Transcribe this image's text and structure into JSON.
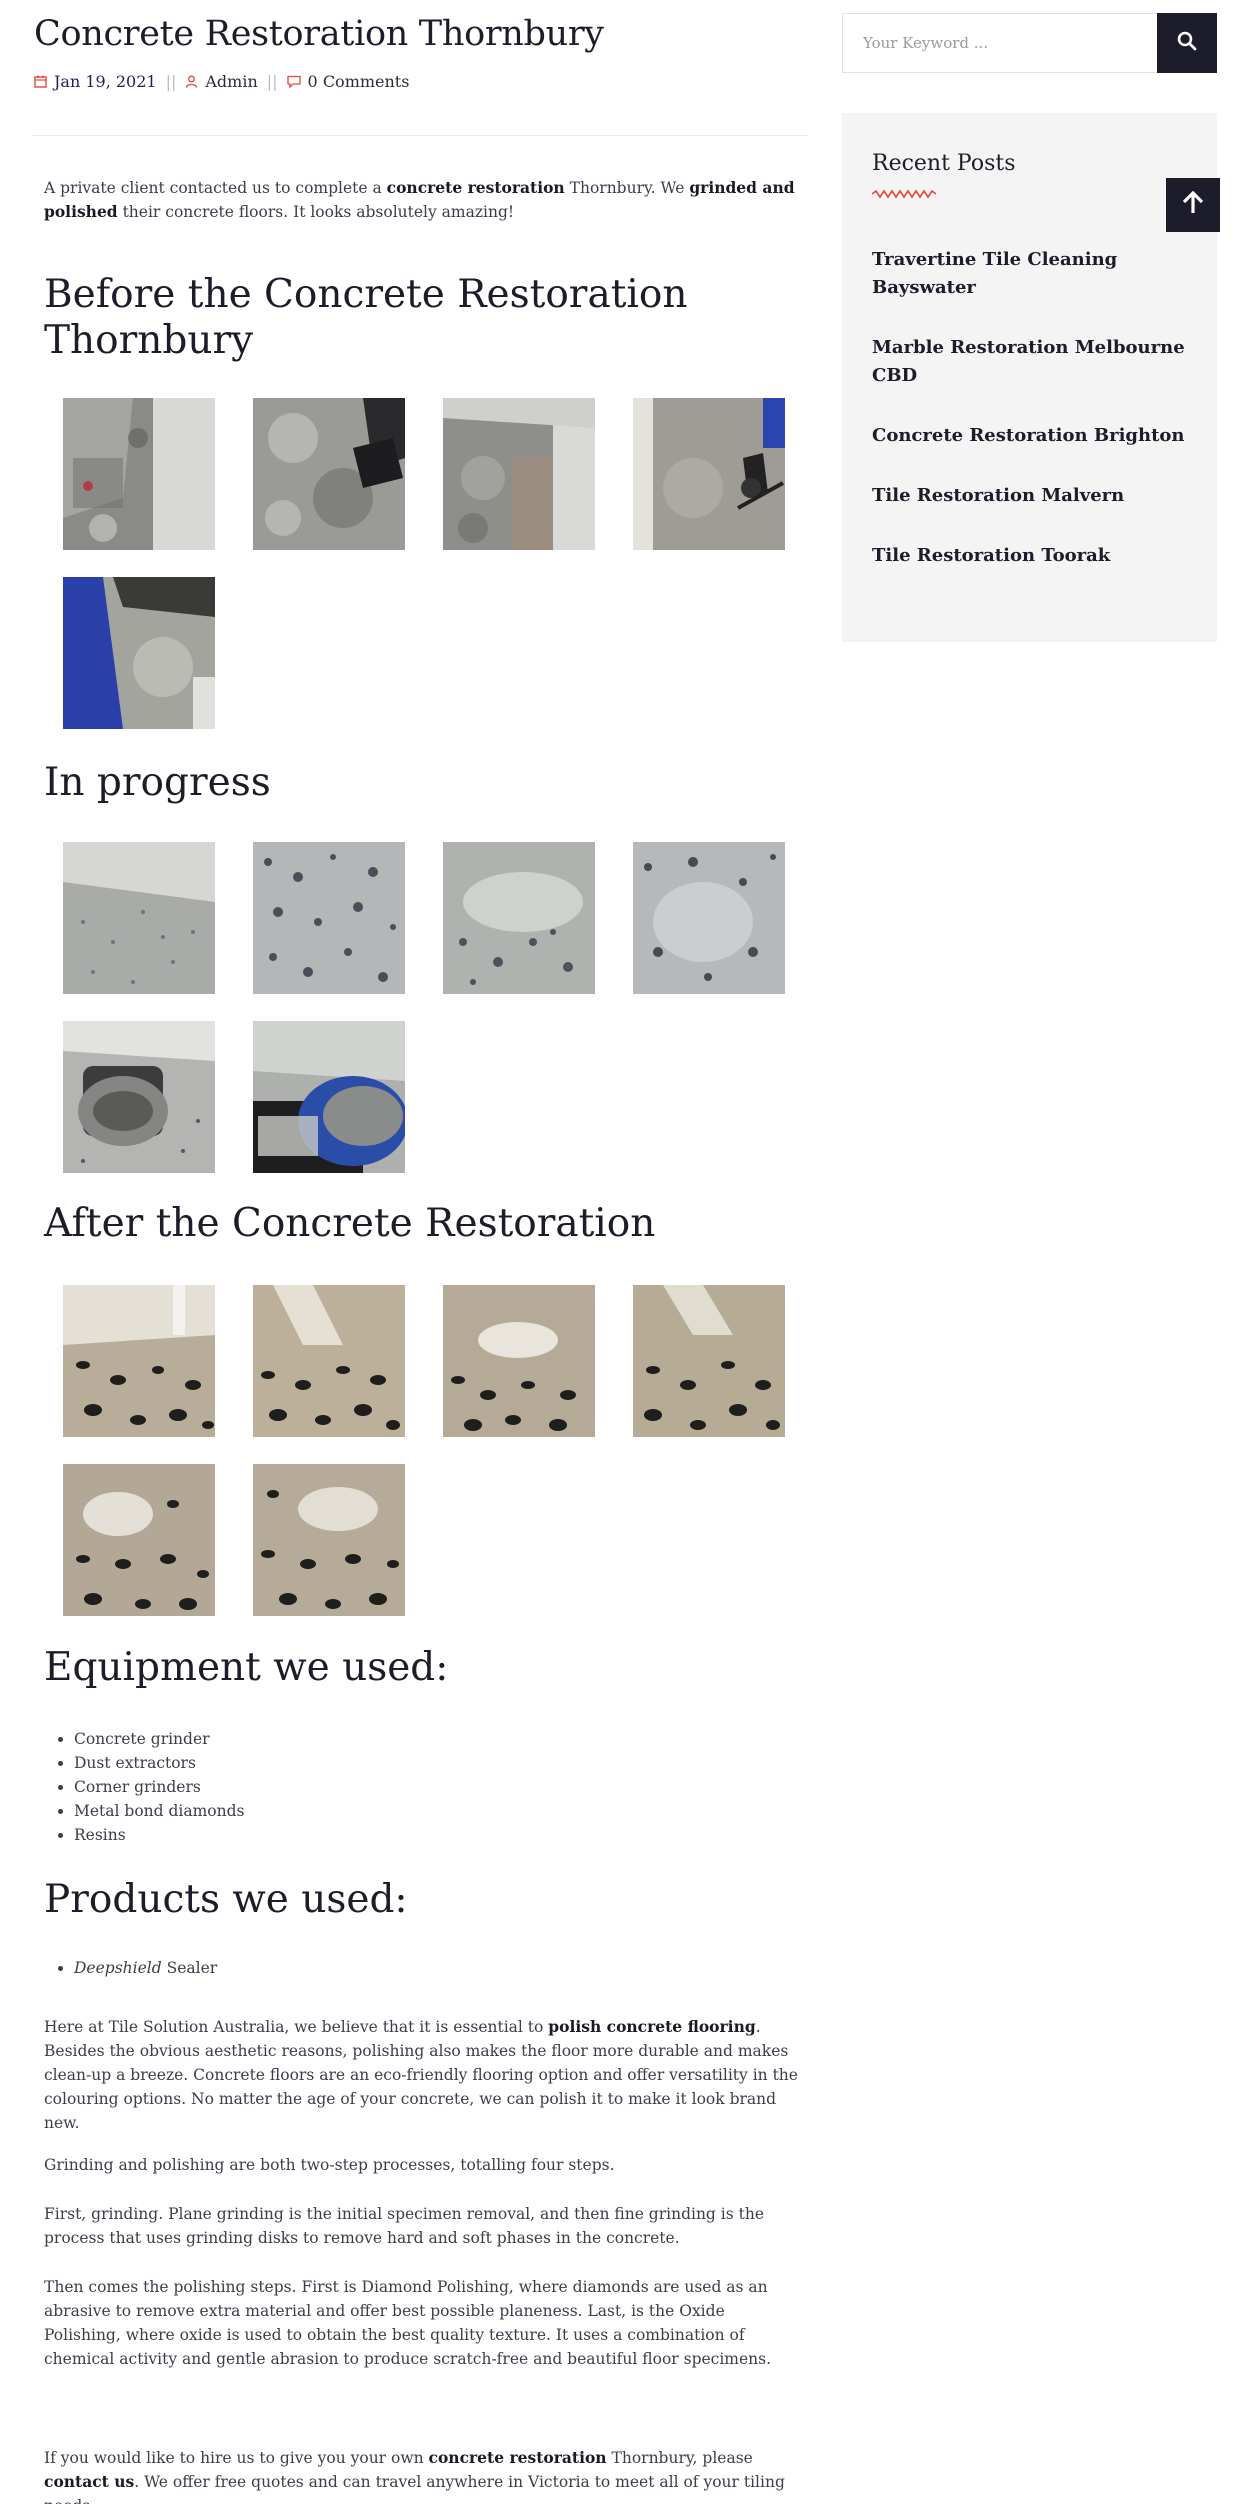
{
  "post": {
    "title": "Concrete Restoration Thornbury",
    "date": "Jan 19, 2021",
    "author": "Admin",
    "comments": "0 Comments"
  },
  "intro": {
    "t1": "A private client contacted us to complete a ",
    "b1": "concrete restoration",
    "t2": " Thornbury. We ",
    "b2": "grinded and polished",
    "t3": " their concrete floors. It looks absolutely amazing!"
  },
  "sections": {
    "before": "Before the Concrete Restoration Thornbury",
    "progress": "In progress",
    "after": "After the Concrete Restoration",
    "equipment": "Equipment we used:",
    "products": "Products we used:"
  },
  "equipment": [
    "Concrete grinder",
    "Dust extractors",
    "Corner grinders",
    "Metal bond diamonds",
    "Resins"
  ],
  "products": {
    "brand": "Deepshield",
    "rest": " Sealer"
  },
  "para1": {
    "t1": "Here at Tile Solution Australia, we believe that it is essential to ",
    "b1": "polish concrete flooring",
    "t2": ". Besides the obvious aesthetic reasons, polishing also makes the floor more durable and makes clean-up a breeze. Concrete floors are an eco-friendly flooring option and offer versatility in the colouring options. No matter the age of your concrete, we can polish it to make it look brand new."
  },
  "para2": "Grinding and polishing are both two-step processes, totalling four steps.",
  "para3": "First, grinding. Plane grinding is the initial specimen removal, and then fine grinding is the process that uses grinding disks to remove hard and soft phases in the concrete.",
  "para4": "Then comes the polishing steps. First is Diamond Polishing, where diamonds are used as an abrasive to remove extra material and offer best possible planeness. Last, is the Oxide Polishing, where oxide is used to obtain the best quality texture. It uses a combination of chemical activity and gentle abrasion to produce scratch-free and beautiful floor specimens.",
  "cta": {
    "t1": "If you would like to hire us to give you your own ",
    "b1": "concrete restoration",
    "t2": " Thornbury, please ",
    "b2": "contact us",
    "t3": ". We offer free quotes and can travel anywhere in Victoria to meet all of your tiling needs."
  },
  "sidebar": {
    "search_placeholder": "Your Keyword ...",
    "recent_title": "Recent Posts",
    "recent": [
      "Travertine Tile Cleaning Bayswater",
      "Marble Restoration Melbourne CBD",
      "Concrete Restoration Brighton",
      "Tile Restoration Malvern",
      "Tile Restoration Toorak"
    ]
  },
  "colors": {
    "accent": "#e6473b",
    "dark": "#1c1c2a",
    "widget_bg": "#f4f4f4"
  }
}
